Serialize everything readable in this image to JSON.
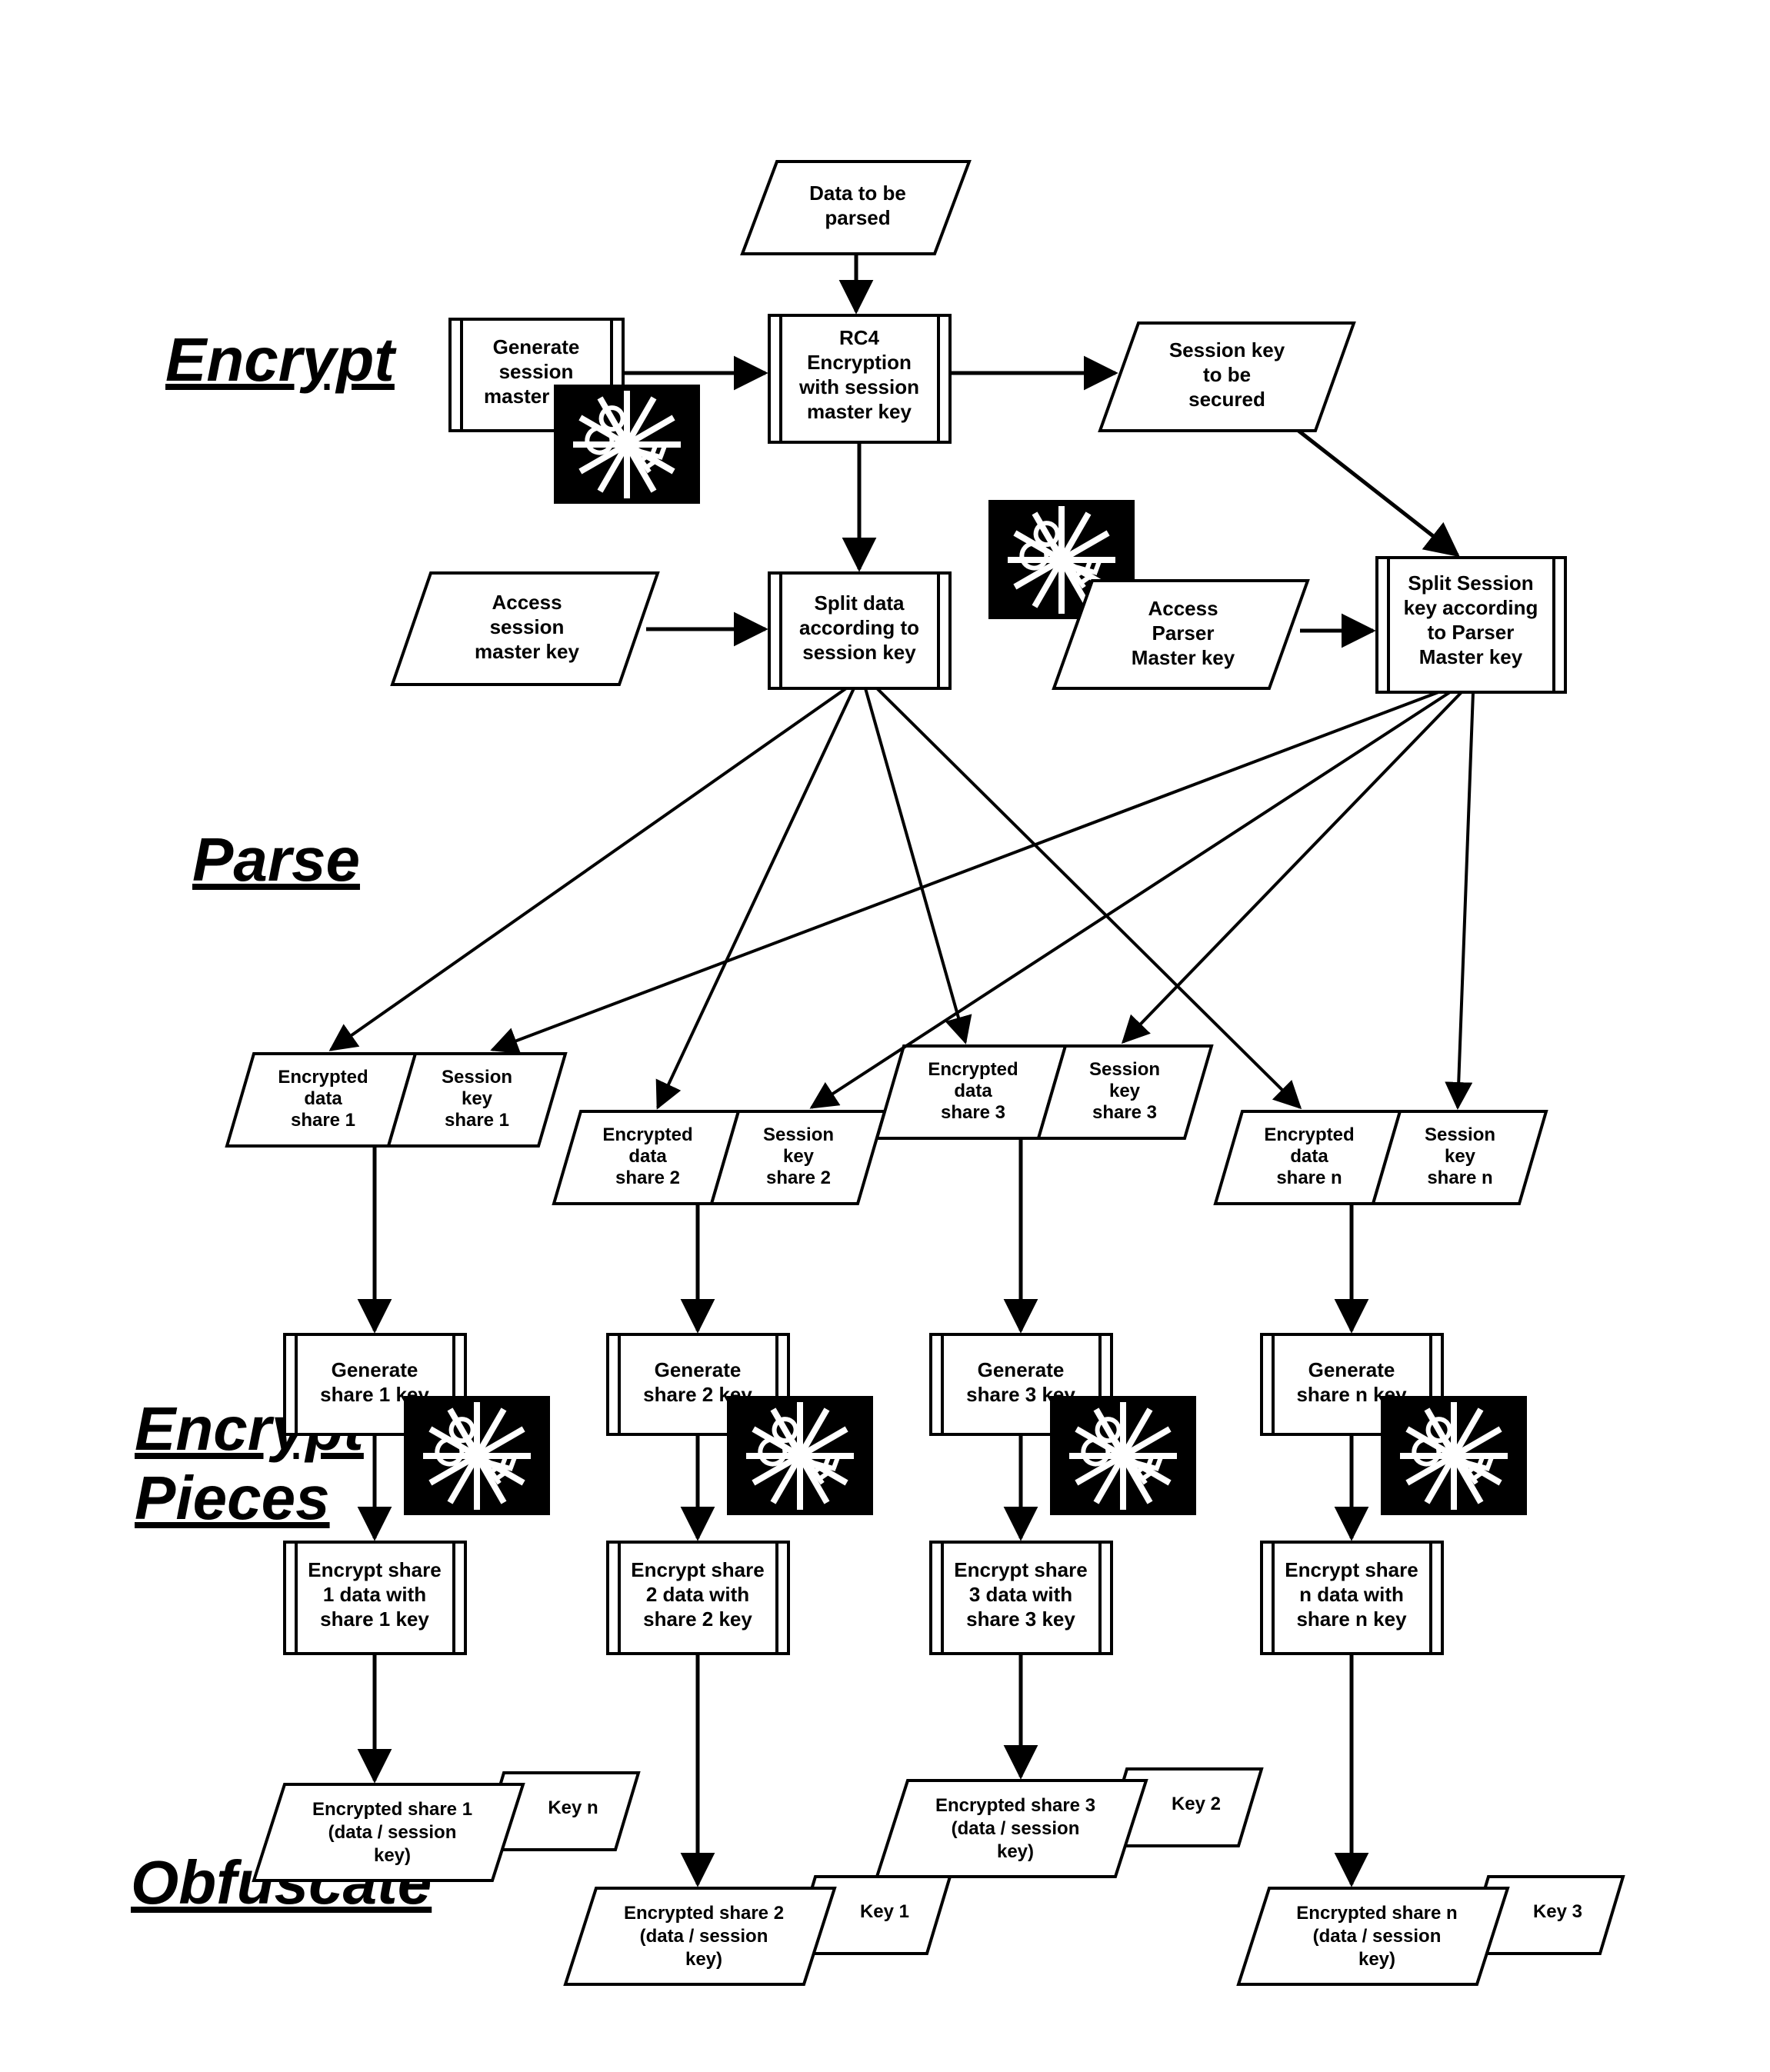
{
  "sections": {
    "encrypt": "Encrypt",
    "parse": "Parse",
    "encrypt_pieces_1": "Encrypt",
    "encrypt_pieces_2": "Pieces",
    "obfuscate": "Obfuscate"
  },
  "nodes": {
    "data_to_be_parsed_1": "Data to be",
    "data_to_be_parsed_2": "parsed",
    "gen_smk_1": "Generate",
    "gen_smk_2": "session",
    "gen_smk_3": "master key",
    "rc4_1": "RC4",
    "rc4_2": "Encryption",
    "rc4_3": "with session",
    "rc4_4": "master key",
    "sess_key_sec_1": "Session key",
    "sess_key_sec_2": "to be",
    "sess_key_sec_3": "secured",
    "access_smk_1": "Access",
    "access_smk_2": "session",
    "access_smk_3": "master key",
    "split_data_1": "Split data",
    "split_data_2": "according to",
    "split_data_3": "session key",
    "access_pmk_1": "Access",
    "access_pmk_2": "Parser",
    "access_pmk_3": "Master key",
    "split_sess_1": "Split Session",
    "split_sess_2": "key according",
    "split_sess_3": "to Parser",
    "split_sess_4": "Master key",
    "eds1_1": "Encrypted",
    "eds1_2": "data",
    "eds1_3": "share 1",
    "sks1_1": "Session",
    "sks1_2": "key",
    "sks1_3": "share 1",
    "eds2_1": "Encrypted",
    "eds2_2": "data",
    "eds2_3": "share 2",
    "sks2_1": "Session",
    "sks2_2": "key",
    "sks2_3": "share 2",
    "eds3_1": "Encrypted",
    "eds3_2": "data",
    "eds3_3": "share 3",
    "sks3_1": "Session",
    "sks3_2": "key",
    "sks3_3": "share 3",
    "edsn_1": "Encrypted",
    "edsn_2": "data",
    "edsn_3": "share n",
    "sksn_1": "Session",
    "sksn_2": "key",
    "sksn_3": "share n",
    "gk1_1": "Generate",
    "gk1_2": "share 1 key",
    "gk2_1": "Generate",
    "gk2_2": "share 2 key",
    "gk3_1": "Generate",
    "gk3_2": "share 3 key",
    "gkn_1": "Generate",
    "gkn_2": "share n key",
    "es1_1": "Encrypt share",
    "es1_2": "1 data with",
    "es1_3": "share 1 key",
    "es2_1": "Encrypt share",
    "es2_2": "2 data with",
    "es2_3": "share 2 key",
    "es3_1": "Encrypt share",
    "es3_2": "3 data with",
    "es3_3": "share 3 key",
    "esn_1": "Encrypt share",
    "esn_2": "n data with",
    "esn_3": "share n key",
    "out1_1": "Encrypted share 1",
    "out1_2": "(data / session",
    "out1_3": "key)",
    "out1_k": "Key n",
    "out2_1": "Encrypted share 2",
    "out2_2": "(data / session",
    "out2_3": "key)",
    "out2_k": "Key 1",
    "out3_1": "Encrypted share 3",
    "out3_2": "(data / session",
    "out3_3": "key)",
    "out3_k": "Key 2",
    "outn_1": "Encrypted share n",
    "outn_2": "(data / session",
    "outn_3": "key)",
    "outn_k": "Key 3"
  }
}
